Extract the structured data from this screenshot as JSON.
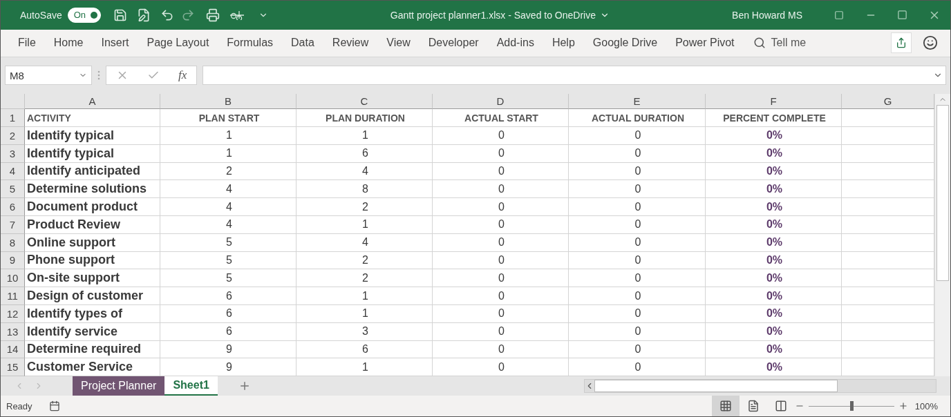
{
  "title_bar": {
    "autosave_label": "AutoSave",
    "autosave_toggle": {
      "label": "On",
      "on": true
    },
    "title": "Gantt project planner1.xlsx  -  Saved to OneDrive",
    "user": "Ben Howard MS"
  },
  "ribbon_tabs": [
    {
      "label": "File",
      "selected": false
    },
    {
      "label": "Home",
      "selected": false
    },
    {
      "label": "Insert",
      "selected": false
    },
    {
      "label": "Page Layout",
      "selected": false
    },
    {
      "label": "Formulas",
      "selected": false
    },
    {
      "label": "Data",
      "selected": false
    },
    {
      "label": "Review",
      "selected": false
    },
    {
      "label": "View",
      "selected": false
    },
    {
      "label": "Developer",
      "selected": false
    },
    {
      "label": "Add-ins",
      "selected": false
    },
    {
      "label": "Help",
      "selected": false
    },
    {
      "label": "Google Drive",
      "selected": false
    },
    {
      "label": "Power Pivot",
      "selected": false
    }
  ],
  "tell_me": {
    "placeholder": "Tell me"
  },
  "formula_bar": {
    "name_box": "M8",
    "fx": "fx"
  },
  "columns": [
    "A",
    "B",
    "C",
    "D",
    "E",
    "F",
    "G"
  ],
  "rows": [
    {
      "number": "1",
      "cells": [
        "ACTIVITY",
        "PLAN START",
        "PLAN DURATION",
        "ACTUAL START",
        "ACTUAL DURATION",
        "PERCENT COMPLETE"
      ]
    },
    {
      "number": "2",
      "cells": [
        "Identify typical",
        "1",
        "1",
        "0",
        "0",
        "0%"
      ]
    },
    {
      "number": "3",
      "cells": [
        "Identify typical",
        "1",
        "6",
        "0",
        "0",
        "0%"
      ]
    },
    {
      "number": "4",
      "cells": [
        "Identify anticipated",
        "2",
        "4",
        "0",
        "0",
        "0%"
      ]
    },
    {
      "number": "5",
      "cells": [
        "Determine solutions",
        "4",
        "8",
        "0",
        "0",
        "0%"
      ]
    },
    {
      "number": "6",
      "cells": [
        "Document product",
        "4",
        "2",
        "0",
        "0",
        "0%"
      ]
    },
    {
      "number": "7",
      "cells": [
        "Product Review",
        "4",
        "1",
        "0",
        "0",
        "0%"
      ]
    },
    {
      "number": "8",
      "cells": [
        "Online support",
        "5",
        "4",
        "0",
        "0",
        "0%"
      ]
    },
    {
      "number": "9",
      "cells": [
        "Phone support",
        "5",
        "2",
        "0",
        "0",
        "0%"
      ]
    },
    {
      "number": "10",
      "cells": [
        "On-site support",
        "5",
        "2",
        "0",
        "0",
        "0%"
      ]
    },
    {
      "number": "11",
      "cells": [
        "Design of customer",
        "6",
        "1",
        "0",
        "0",
        "0%"
      ]
    },
    {
      "number": "12",
      "cells": [
        "Identify types of",
        "6",
        "1",
        "0",
        "0",
        "0%"
      ]
    },
    {
      "number": "13",
      "cells": [
        "Identify service",
        "6",
        "3",
        "0",
        "0",
        "0%"
      ]
    },
    {
      "number": "14",
      "cells": [
        "Determine required",
        "9",
        "6",
        "0",
        "0",
        "0%"
      ]
    },
    {
      "number": "15",
      "cells": [
        "Customer Service",
        "9",
        "1",
        "0",
        "0",
        "0%"
      ]
    }
  ],
  "sheet_tabs": [
    {
      "label": "Project Planner",
      "selected": false,
      "color": "#715572"
    },
    {
      "label": "Sheet1",
      "selected": true
    }
  ],
  "status_bar": {
    "status": "Ready",
    "zoom": {
      "level": 0.5,
      "reading": "100%"
    }
  }
}
